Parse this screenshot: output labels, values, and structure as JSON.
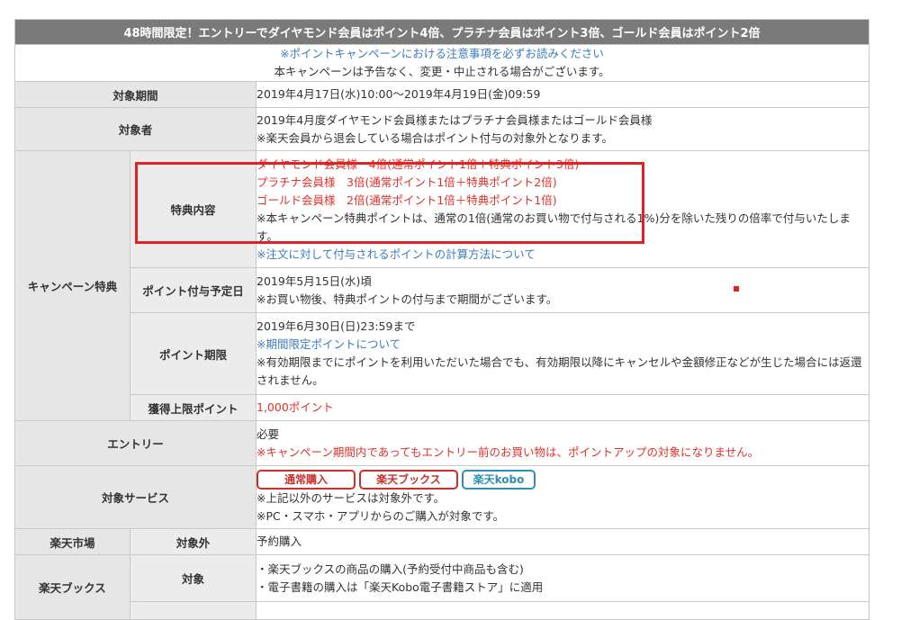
{
  "header": "48時間限定！エントリーでダイヤモンド会員はポイント4倍、プラチナ会員はポイント3倍、ゴールド会員はポイント2倍",
  "notice": {
    "link": "※ポイントキャンペーンにおける注意事項を必ずお読みください",
    "text": "本キャンペーンは予告なく、変更・中止される場合がございます。"
  },
  "period": {
    "label": "対象期間",
    "value": "2019年4月17日(水)10:00～2019年4月19日(金)09:59"
  },
  "target": {
    "label": "対象者",
    "line1": "2019年4月度ダイヤモンド会員様またはプラチナ会員様またはゴールド会員様",
    "line2": "※楽天会員から退会している場合はポイント付与の対象外となります。"
  },
  "campaign": {
    "label": "キャンペーン特典",
    "benefit": {
      "label": "特典内容",
      "diamond": "ダイヤモンド会員様　4倍(通常ポイント1倍＋特典ポイント3倍)",
      "platinum": "プラチナ会員様　3倍(通常ポイント1倍＋特典ポイント2倍)",
      "gold": "ゴールド会員様　2倍(通常ポイント1倍＋特典ポイント1倍)",
      "note1": "※本キャンペーン特典ポイントは、通常の1倍(通常のお買い物で付与される1%)分を除いた残りの倍率で付与いたします。",
      "note2": "※注文に対して付与されるポイントの計算方法について"
    },
    "schedule": {
      "label": "ポイント付与予定日",
      "line1": "2019年5月15日(水)頃",
      "line2": "※お買い物後、特典ポイントの付与まで期間がございます。"
    },
    "expiry": {
      "label": "ポイント期限",
      "line1": "2019年6月30日(日)23:59まで",
      "line2": "※期間限定ポイントについて",
      "line3": "※有効期限までにポイントを利用いただいた場合でも、有効期限以降にキャンセルや金額修正などが生じた場合には返還されません。"
    },
    "cap": {
      "label": "獲得上限ポイント",
      "value": "1,000ポイント"
    }
  },
  "entry": {
    "label": "エントリー",
    "line1": "必要",
    "line2": "※キャンペーン期間内であってもエントリー前のお買い物は、ポイントアップの対象になりません。"
  },
  "service": {
    "label": "対象サービス",
    "pills": [
      "通常購入",
      "楽天ブックス",
      "楽天kobo"
    ],
    "line1": "※上記以外のサービスは対象外です。",
    "line2": "※PC・スマホ・アプリからのご購入が対象です。"
  },
  "ichiba": {
    "label": "楽天市場",
    "sub": "対象外",
    "value": "予約購入"
  },
  "books": {
    "label": "楽天ブックス",
    "sub": "対象",
    "line1": "・楽天ブックスの商品の購入(予約受付中商品も含む)",
    "line2": "・電子書籍の購入は「楽天Kobo電子書籍ストア」に適用"
  }
}
